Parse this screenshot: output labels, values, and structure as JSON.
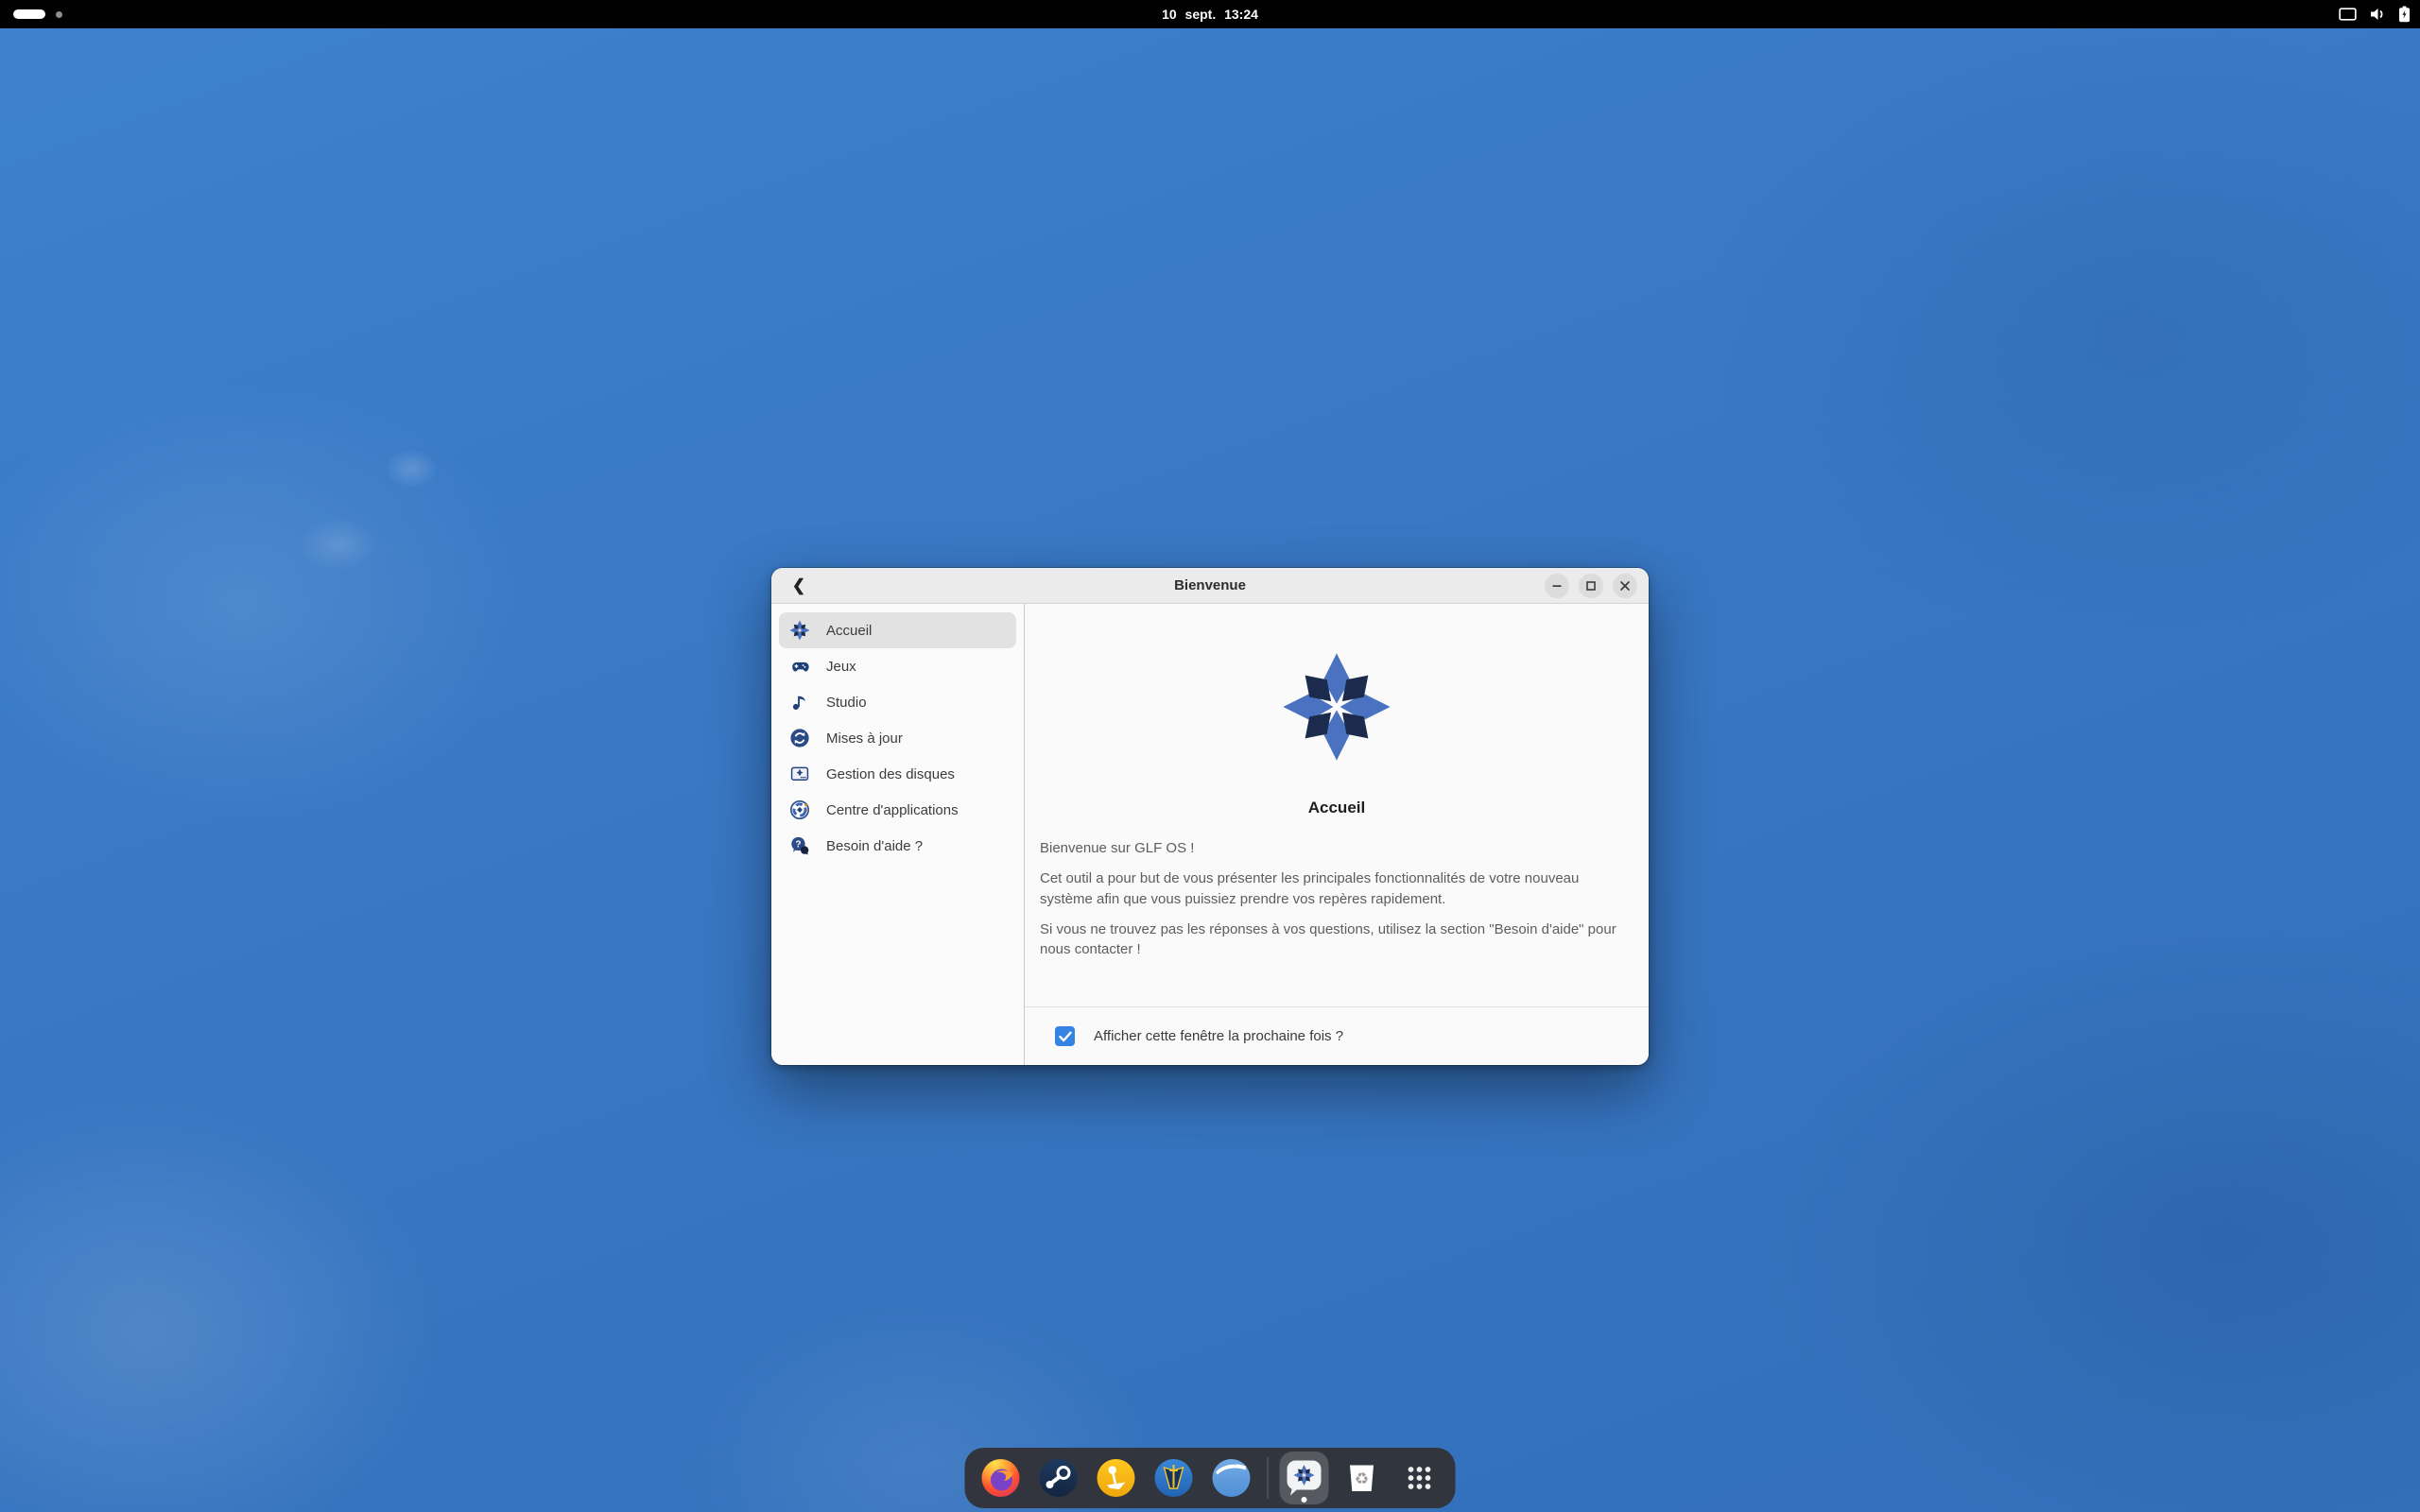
{
  "topbar": {
    "clock": "10 sept. 13:24",
    "workspaces": {
      "current": 1,
      "total": 2
    },
    "status_icons": [
      "screen-cast",
      "volume",
      "battery-charging"
    ]
  },
  "window": {
    "titlebar": {
      "title": "Bienvenue",
      "back_glyph": "❮",
      "controls": [
        "minimize",
        "maximize",
        "close"
      ]
    },
    "sidebar": {
      "items": [
        {
          "label": "Accueil",
          "icon": "glf-snowflake",
          "selected": true
        },
        {
          "label": "Jeux",
          "icon": "gamepad"
        },
        {
          "label": "Studio",
          "icon": "music-note"
        },
        {
          "label": "Mises à jour",
          "icon": "refresh"
        },
        {
          "label": "Gestion des disques",
          "icon": "disk-drive"
        },
        {
          "label": "Centre d'applications",
          "icon": "app-center"
        },
        {
          "label": "Besoin d'aide ?",
          "icon": "help-bubbles"
        }
      ]
    },
    "content": {
      "heading": "Accueil",
      "paragraphs": [
        "Bienvenue sur GLF OS !",
        "Cet outil a pour but de vous présenter les principales fonctionnalités de votre nouveau système afin que vous puissiez prendre vos repères rapidement.",
        "Si vous ne trouvez pas les réponses à vos questions, utilisez la section \"Besoin d'aide\" pour nous contacter !"
      ],
      "checkbox": {
        "checked": true,
        "label": "Afficher cette fenêtre la prochaine fois ?"
      }
    }
  },
  "dock": {
    "items": [
      {
        "icon": "firefox"
      },
      {
        "icon": "steam"
      },
      {
        "icon": "lutris"
      },
      {
        "icon": "heroic-games"
      },
      {
        "icon": "web-browser"
      },
      {
        "icon": "glf-welcome",
        "active": true,
        "running": true
      },
      {
        "icon": "trash"
      },
      {
        "icon": "show-apps"
      }
    ]
  },
  "colors": {
    "accent": "#3584e4",
    "wallpaper": "#3a7ac6",
    "titlebar": "#ebebeb",
    "dock_bg": "#313136",
    "logo_blue": "#4a72c0",
    "logo_navy": "#1c2b4d"
  }
}
